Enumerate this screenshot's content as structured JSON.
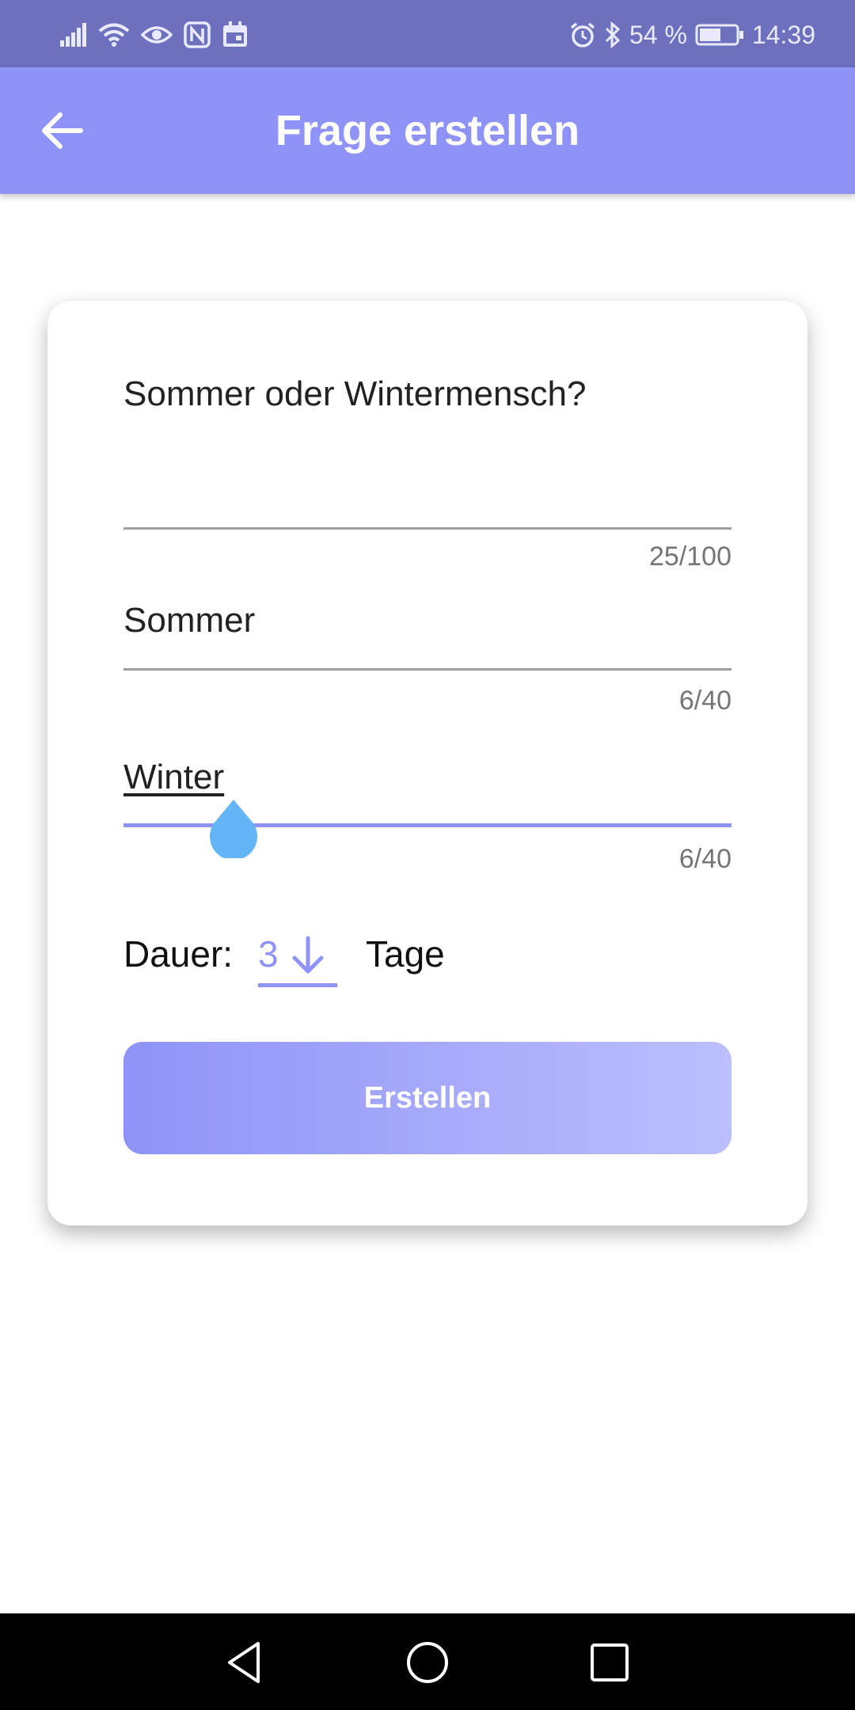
{
  "status_bar": {
    "battery": "54 %",
    "time": "14:39",
    "icons_left": [
      "signal-icon",
      "wifi-icon",
      "eye-icon",
      "nfc-icon",
      "calendar-icon"
    ],
    "icons_right": [
      "alarm-icon",
      "bluetooth-icon",
      "battery-icon"
    ]
  },
  "app_bar": {
    "title": "Frage erstellen",
    "back_icon": "arrow-back-icon"
  },
  "form": {
    "question": {
      "value": "Sommer oder Wintermensch?",
      "counter": "25/100"
    },
    "option1": {
      "value": "Sommer",
      "counter": "6/40"
    },
    "option2": {
      "value": "Winter",
      "counter": "6/40"
    },
    "duration": {
      "label": "Dauer:",
      "value": "3",
      "unit": "Tage",
      "arrow_icon": "arrow-down-icon"
    },
    "submit_label": "Erstellen"
  },
  "nav_bar": {
    "icons": [
      "back-triangle-icon",
      "home-circle-icon",
      "recents-square-icon"
    ]
  },
  "colors": {
    "status_bar": "#6c70bd",
    "app_bar": "#8f93f7",
    "accent": "#8f93f7",
    "cursor_handle": "#64b5f6",
    "button_gradient_end": "#bcbffc"
  }
}
